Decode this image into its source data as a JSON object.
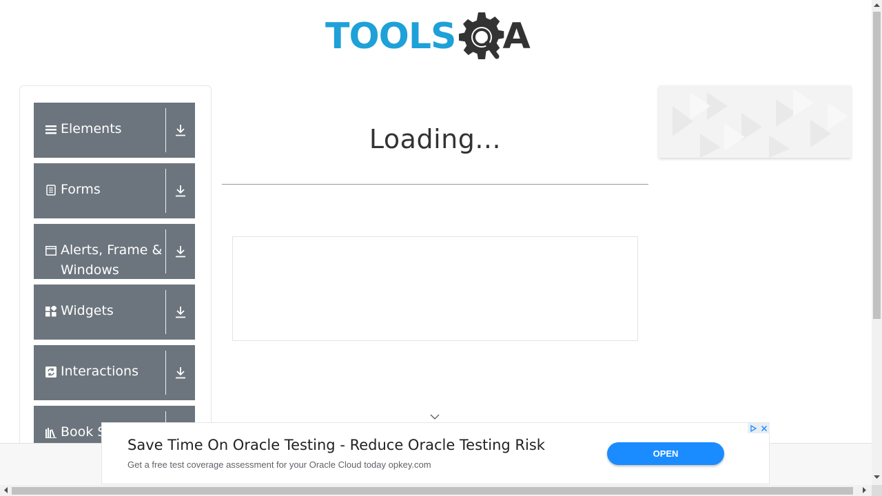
{
  "header": {
    "logo_text_left": "TOOLS",
    "logo_text_right": "A",
    "logo_icon": "gear-magnifier-icon"
  },
  "sidebar": {
    "groups": [
      {
        "label": "Elements",
        "icon": "hamburger-icon"
      },
      {
        "label": "Forms",
        "icon": "document-icon"
      },
      {
        "label": "Alerts, Frame & Windows",
        "icon": "window-icon"
      },
      {
        "label": "Widgets",
        "icon": "widgets-icon"
      },
      {
        "label": "Interactions",
        "icon": "refresh-icon"
      },
      {
        "label": "Book Store Application",
        "icon": "books-icon"
      }
    ],
    "toggle_icon": "download-arrow-icon"
  },
  "main": {
    "loading_text": "Loading..."
  },
  "ad": {
    "title": "Save Time On Oracle Testing - Reduce Oracle Testing Risk",
    "subtitle": "Get a free test coverage assessment for your Oracle Cloud today opkey.com",
    "button_label": "OPEN",
    "button_color": "#1a8cff"
  },
  "colors": {
    "accent": "#1ea1d8",
    "sidebar_bg": "#6c757d",
    "logo_dark": "#333333"
  }
}
